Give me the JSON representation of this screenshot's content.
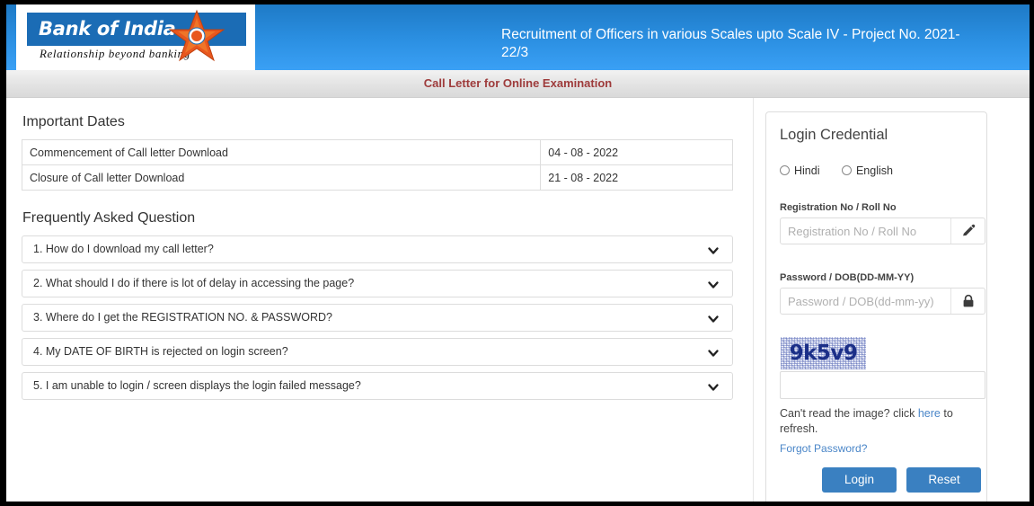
{
  "header": {
    "logo_text": "Bank of India",
    "logo_tagline": "Relationship beyond banking",
    "logo_star_icon": "star-icon",
    "title": "Recruitment of Officers in various Scales upto Scale IV - Project No. 2021-22/3"
  },
  "subtitle": {
    "text": "Call Letter for Online Examination",
    "color": "#9e3b3b"
  },
  "important_dates": {
    "title": "Important Dates",
    "rows": [
      {
        "label": "Commencement of Call letter Download",
        "value": "04 - 08 - 2022"
      },
      {
        "label": "Closure of Call letter Download",
        "value": "21 - 08 - 2022"
      }
    ]
  },
  "faq": {
    "title": "Frequently Asked Question",
    "chevron_icon": "chevron-down-icon",
    "items": [
      {
        "question": "1. How do I download my call letter?"
      },
      {
        "question": "2. What should I do if there is lot of delay in accessing the page?"
      },
      {
        "question": "3. Where do I get the REGISTRATION NO. & PASSWORD?"
      },
      {
        "question": "4. My DATE OF BIRTH is rejected on login screen?"
      },
      {
        "question": "5. I am unable to login / screen displays the login failed message?"
      }
    ]
  },
  "login": {
    "title": "Login Credential",
    "language_options": [
      {
        "label": "Hindi",
        "selected": false
      },
      {
        "label": "English",
        "selected": false
      }
    ],
    "registration": {
      "label": "Registration No / Roll No",
      "placeholder": "Registration No / Roll No",
      "value": "",
      "icon": "pencil-icon"
    },
    "password": {
      "label": "Password / DOB(DD-MM-YY)",
      "placeholder": "Password / DOB(dd-mm-yy)",
      "value": "",
      "icon": "lock-icon"
    },
    "captcha": {
      "text": "9k5v9",
      "input_value": "",
      "input_placeholder": ""
    },
    "refresh_note_before": "Can't read the image? click ",
    "refresh_link": "here",
    "refresh_note_after": " to refresh.",
    "forgot_password": "Forgot Password?",
    "login_button": "Login",
    "reset_button": "Reset",
    "accent_color": "#3a80c1"
  }
}
